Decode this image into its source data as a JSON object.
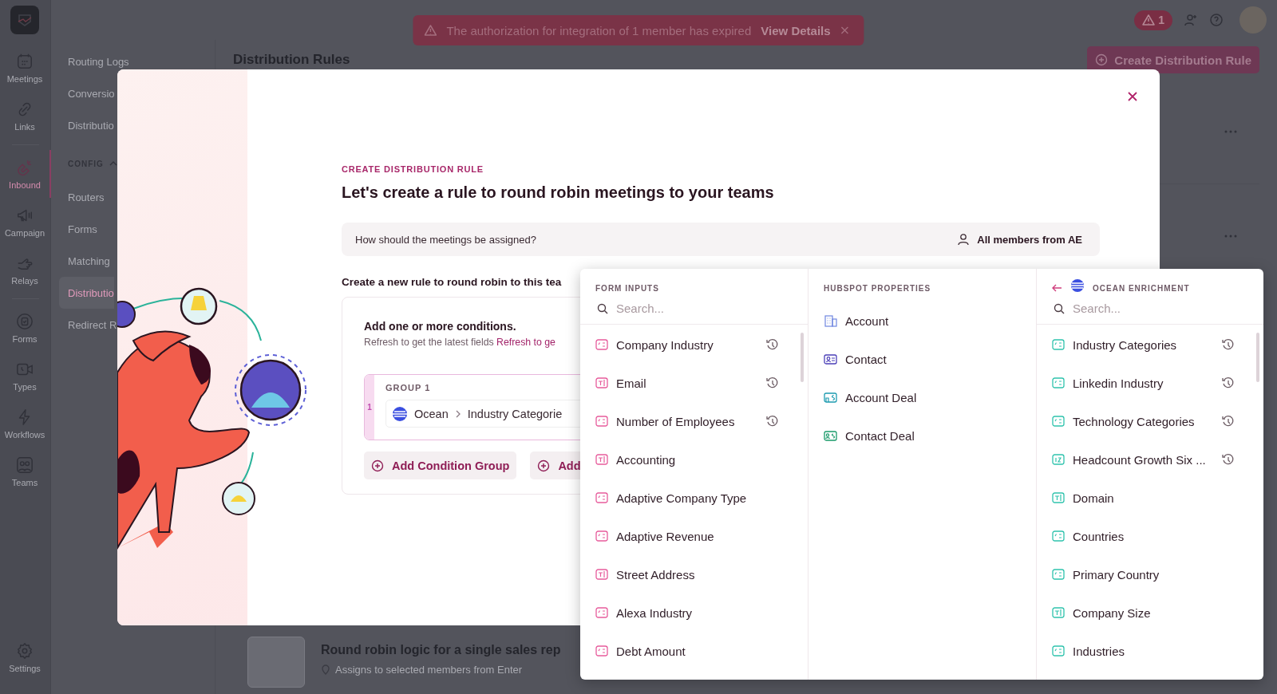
{
  "app_rail": {
    "groups": [
      [
        {
          "label": "Meetings",
          "kind": "calendar",
          "selected": false
        },
        {
          "label": "Links",
          "kind": "link",
          "selected": false
        }
      ],
      [
        {
          "label": "Inbound",
          "kind": "magnet",
          "selected": true
        },
        {
          "label": "Campaign",
          "kind": "megaphone",
          "selected": false
        },
        {
          "label": "Relays",
          "kind": "hand",
          "selected": false
        }
      ],
      [
        {
          "label": "Forms",
          "kind": "form",
          "selected": false
        },
        {
          "label": "Types",
          "kind": "video",
          "selected": false
        },
        {
          "label": "Workflows",
          "kind": "bolt",
          "selected": false
        },
        {
          "label": "Teams",
          "kind": "team",
          "selected": false
        }
      ]
    ],
    "footer": {
      "label": "Settings",
      "kind": "gear",
      "selected": false
    }
  },
  "sub_nav": {
    "items": [
      {
        "label": "Routing Logs",
        "kind": "link",
        "selected": false
      },
      {
        "label": "Conversio",
        "kind": "link",
        "selected": false
      },
      {
        "label": "Distributio",
        "kind": "link",
        "selected": false
      },
      {
        "label": "CONFIG",
        "kind": "heading",
        "expanded": true
      },
      {
        "label": "Routers",
        "kind": "link",
        "selected": false
      },
      {
        "label": "Forms",
        "kind": "link",
        "selected": false
      },
      {
        "label": "Matching",
        "kind": "link",
        "selected": false
      },
      {
        "label": "Distributio",
        "kind": "link",
        "selected": true
      },
      {
        "label": "Redirect R",
        "kind": "link",
        "selected": false
      }
    ]
  },
  "alert_banner": {
    "message": "The authorization for integration of 1 member has expired",
    "action": "View Details"
  },
  "top_bar": {
    "alert_count": "1"
  },
  "page": {
    "title": "Distribution Rules",
    "create_button": "Create Distribution Rule",
    "rules": [
      {
        "title": "Round robin logic for a single sales rep",
        "subtitle": "Assigns to selected members from Enter"
      }
    ]
  },
  "modal": {
    "kicker": "CREATE DISTRIBUTION RULE",
    "title": "Let's create a rule to round robin meetings to your teams",
    "assign": {
      "question": "How should the meetings be assigned?",
      "value": "All members from AE"
    },
    "section_title": "Create a new rule to round robin to this tea",
    "conditions": {
      "title": "Add one or more conditions.",
      "hint": "Refresh to get the latest fields",
      "hint_link": "Refresh to ge",
      "groups": [
        {
          "label": "GROUP 1",
          "number": "1",
          "condition": {
            "source": "Ocean",
            "field": "Industry Categorie"
          }
        }
      ],
      "buttons": [
        "Add Condition Group",
        "Add"
      ]
    }
  },
  "field_picker": {
    "columns": [
      {
        "title": "FORM INPUTS",
        "kind": "form",
        "back_button": false,
        "search": {
          "placeholder": "Search..."
        },
        "items": [
          {
            "label": "Company Industry",
            "kind": "picklist",
            "synced": true
          },
          {
            "label": "Email",
            "kind": "text",
            "synced": true
          },
          {
            "label": "Number of Employees",
            "kind": "picklist",
            "synced": true
          },
          {
            "label": "Accounting",
            "kind": "text",
            "synced": false
          },
          {
            "label": "Adaptive Company Type",
            "kind": "picklist",
            "synced": false
          },
          {
            "label": "Adaptive Revenue",
            "kind": "picklist",
            "synced": false
          },
          {
            "label": "Street Address",
            "kind": "text",
            "synced": false
          },
          {
            "label": "Alexa Industry",
            "kind": "picklist",
            "synced": false
          },
          {
            "label": "Debt Amount",
            "kind": "picklist",
            "synced": false
          }
        ]
      },
      {
        "title": "HUBSPOT PROPERTIES",
        "kind": "hubspot",
        "back_button": false,
        "items": [
          {
            "label": "Account",
            "kind": "account",
            "synced": false
          },
          {
            "label": "Contact",
            "kind": "contact",
            "synced": false
          },
          {
            "label": "Account Deal",
            "kind": "account_deal",
            "synced": false
          },
          {
            "label": "Contact Deal",
            "kind": "contact_deal",
            "synced": false
          }
        ]
      },
      {
        "title": "OCEAN ENRICHMENT",
        "kind": "ocean",
        "back_button": true,
        "search": {
          "placeholder": "Search..."
        },
        "items": [
          {
            "label": "Industry Categories",
            "kind": "picklist",
            "synced": true
          },
          {
            "label": "Linkedin Industry",
            "kind": "picklist",
            "synced": true
          },
          {
            "label": "Technology Categories",
            "kind": "picklist",
            "synced": true
          },
          {
            "label": "Headcount Growth Six ...",
            "kind": "number",
            "synced": true
          },
          {
            "label": "Domain",
            "kind": "text",
            "synced": false
          },
          {
            "label": "Countries",
            "kind": "picklist",
            "synced": false
          },
          {
            "label": "Primary Country",
            "kind": "picklist",
            "synced": false
          },
          {
            "label": "Company Size",
            "kind": "text",
            "synced": false
          },
          {
            "label": "Industries",
            "kind": "picklist",
            "synced": false
          }
        ]
      }
    ]
  }
}
